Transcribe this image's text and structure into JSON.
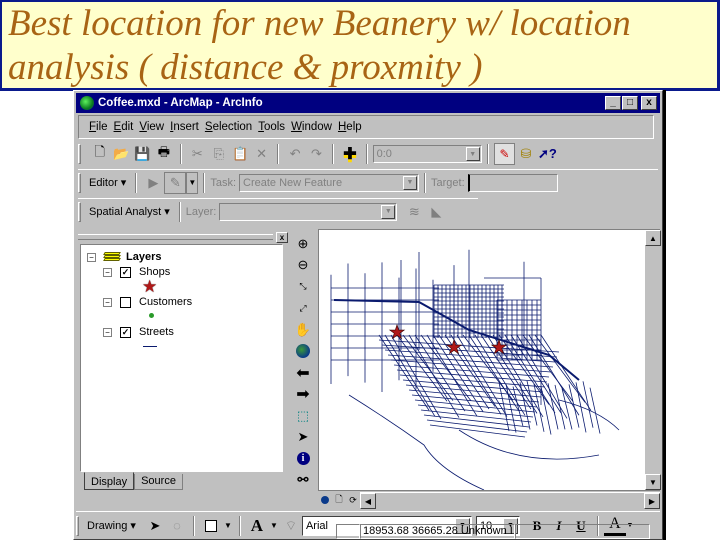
{
  "slide": {
    "title": "Best location for new Beanery w/ location\nanalysis ( distance & proxmity )",
    "colors": {
      "title_text": "#a86414",
      "title_bg": "#ffffcc",
      "title_border": "#0a1a8c"
    }
  },
  "window": {
    "title": "Coffee.mxd - ArcMap - ArcInfo",
    "controls": {
      "minimize": "_",
      "maximize": "□",
      "close": "x"
    }
  },
  "menu": [
    "File",
    "Edit",
    "View",
    "Insert",
    "Selection",
    "Tools",
    "Window",
    "Help"
  ],
  "menu_mnemonics": [
    "F",
    "E",
    "V",
    "I",
    "S",
    "T",
    "W",
    "H"
  ],
  "standard_toolbar": {
    "icons": [
      "new-icon",
      "open-icon",
      "save-icon",
      "print-icon",
      "cut-icon",
      "copy-icon",
      "paste-icon",
      "delete-icon",
      "undo-icon",
      "redo-icon",
      "add-data-icon"
    ],
    "scale_value": "0:0",
    "right_icons": [
      "editor-toolbar-icon",
      "arctoolbox-icon",
      "whats-this-icon"
    ]
  },
  "editor_toolbar": {
    "editor_label": "Editor",
    "task_label": "Task:",
    "task_value": "Create New Feature",
    "target_label": "Target:",
    "target_value": ""
  },
  "spatial_analyst_toolbar": {
    "label": "Spatial Analyst",
    "layer_label": "Layer:",
    "layer_value": ""
  },
  "toc": {
    "root": "Layers",
    "layers": [
      {
        "name": "Shops",
        "checked": true,
        "symbol": "red-star"
      },
      {
        "name": "Customers",
        "checked": false,
        "symbol": "green-dot"
      },
      {
        "name": "Streets",
        "checked": true,
        "symbol": "line"
      }
    ],
    "tabs": [
      "Display",
      "Source"
    ],
    "active_tab": "Display"
  },
  "tools": [
    "zoom-in",
    "zoom-out",
    "fixed-zoom-in",
    "fixed-zoom-out",
    "pan",
    "full-extent",
    "back",
    "forward",
    "select-features",
    "select-elements",
    "identify",
    "find"
  ],
  "map": {
    "shops_markers": 3,
    "street_color": "#0a1a6e",
    "marker_color": "#b01818"
  },
  "drawing_toolbar": {
    "label": "Drawing",
    "font": "Arial",
    "font_size": "10",
    "bold": "B",
    "italic": "I",
    "underline": "U",
    "text_tool": "A"
  },
  "status": {
    "coords": "18953.68  36665.28 Unknown I"
  }
}
